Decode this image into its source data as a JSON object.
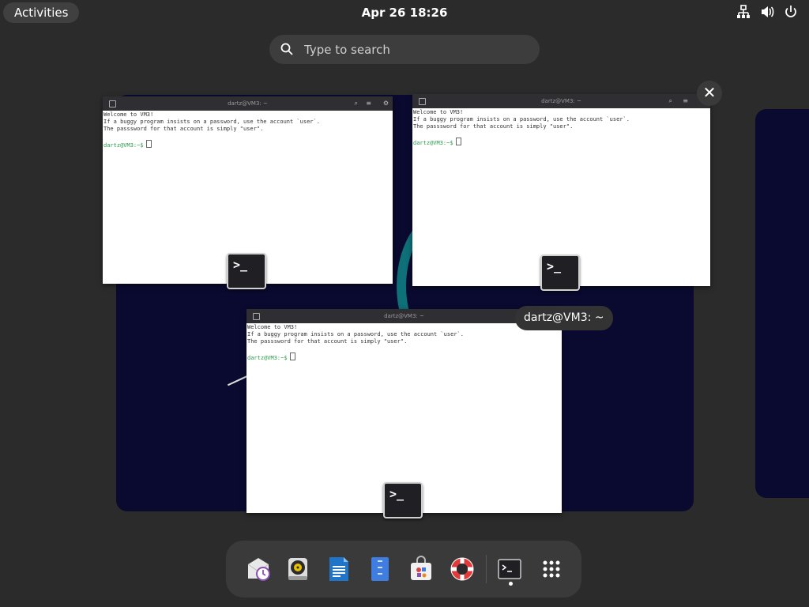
{
  "topbar": {
    "activities_label": "Activities",
    "clock": "Apr 26  18:26",
    "tray": [
      "network-icon",
      "volume-icon",
      "power-icon"
    ]
  },
  "search": {
    "placeholder": "Type to search"
  },
  "windows": [
    {
      "title": "dartz@VM3: ~",
      "lines": [
        "Welcome to VM3!",
        "If a buggy program insists on a password, use the account `user`.",
        "The passsword for that account is simply \"user\"."
      ],
      "prompt": "dartz@VM3:~$"
    },
    {
      "title": "dartz@VM3: ~",
      "lines": [
        "Welcome to VM3!",
        "If a buggy program insists on a password, use the account `user`.",
        "The passsword for that account is simply \"user\"."
      ],
      "prompt": "dartz@VM3:~$"
    },
    {
      "title": "dartz@VM3: ~",
      "lines": [
        "Welcome to VM3!",
        "If a buggy program insists on a password, use the account `user`.",
        "The passsword for that account is simply \"user\"."
      ],
      "prompt": "dartz@VM3:~$"
    }
  ],
  "terminal_icon_text": ">_",
  "tooltip": "dartz@VM3: ~",
  "close_label": "✕",
  "dock": {
    "apps": [
      "evolution-mail-calendar",
      "rhythmbox",
      "libreoffice-writer",
      "file-manager",
      "software-center",
      "help",
      "terminal",
      "show-apps"
    ]
  },
  "colors": {
    "accent": "#0f7c80",
    "workspace_bg": "#0a0a30",
    "prompt": "#2a9a4a"
  }
}
